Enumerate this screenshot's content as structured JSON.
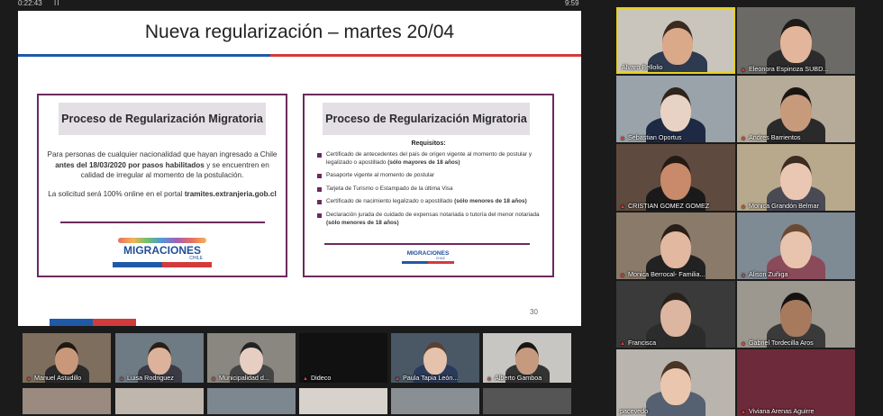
{
  "meeting": {
    "elapsed_time": "0:22:43",
    "pause_symbol": "II",
    "end_time": "9:59"
  },
  "slide": {
    "title": "Nueva regularización – martes 20/04",
    "page_number": "30",
    "left_card": {
      "heading": "Proceso de Regularización Migratoria",
      "intro_plain_1": "Para personas de cualquier nacionalidad que hayan ingresado a Chile ",
      "intro_bold": "antes del 18/03/2020 por pasos habilitados",
      "intro_plain_2": " y se encuentren en calidad de irregular al momento de la postulación.",
      "portal_plain": "La solicitud será 100% online en el portal ",
      "portal_bold": "tramites.extranjeria.gob.cl",
      "logo_text": "MIGRACIONES",
      "logo_sub": "CHILE"
    },
    "right_card": {
      "heading": "Proceso de Regularización Migratoria",
      "requirements_title": "Requisitos:",
      "requirements": [
        {
          "text": "Certificado de antecedentes del país de origen vigente al momento de postular y legalizado o apostillado ",
          "note": "(sólo mayores de 18 años)"
        },
        {
          "text": "Pasaporte vigente al momento de postular",
          "note": ""
        },
        {
          "text": "Tarjeta de Turismo o Estampado de la última Visa",
          "note": ""
        },
        {
          "text": "Certificado de nacimiento legalizado o apostillado ",
          "note": "(sólo menores de 18 años)"
        },
        {
          "text": "Declaración jurada de cuidado de expensas notariada o tutoría del menor notariada ",
          "note": "(sólo menores de 18 años)"
        }
      ],
      "logo_text": "MIGRACIONES",
      "logo_sub": "CHILE"
    }
  },
  "bottom_strip": [
    {
      "name": "Manuel Astudillo",
      "muted": true
    },
    {
      "name": "Luisa Rodriguez",
      "muted": true
    },
    {
      "name": "Municipalidad d...",
      "muted": true
    },
    {
      "name": "Dideco",
      "muted": true
    },
    {
      "name": "Paula Tapia León...",
      "muted": true
    },
    {
      "name": "Alberto Gamboa",
      "muted": true
    }
  ],
  "gallery": [
    {
      "name": "Alvaro Bellolio",
      "muted": false,
      "active": true
    },
    {
      "name": "Eleonora Espinoza SUBD...",
      "muted": true
    },
    {
      "name": "Sebastian Oportus",
      "muted": true
    },
    {
      "name": "Andres Barrientos",
      "muted": true
    },
    {
      "name": "CRISTIAN GOMEZ GOMEZ",
      "muted": true
    },
    {
      "name": "Monica Grandón Belmar",
      "muted": true
    },
    {
      "name": "Monica Berrocal- Familia...",
      "muted": true
    },
    {
      "name": "Alison Zuñiga",
      "muted": true
    },
    {
      "name": "Francisca",
      "muted": true
    },
    {
      "name": "Gabriel Tordecilla Aros",
      "muted": true
    },
    {
      "name": "pacevedo",
      "muted": false
    },
    {
      "name": "Viviana Arenas Aguirre",
      "muted": true
    }
  ],
  "colors": {
    "accent_purple": "#6b2a5e",
    "flag_blue": "#1f5aa8",
    "flag_red": "#d23b3b",
    "active_speaker": "#e6d21c"
  },
  "icons": {
    "muted_mic": "muted-mic-icon",
    "pause": "pause-icon"
  }
}
